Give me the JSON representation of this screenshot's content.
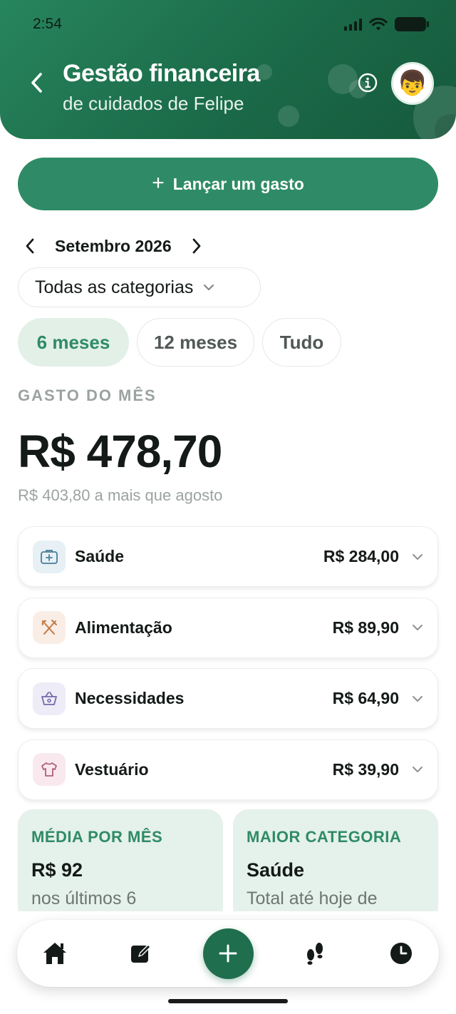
{
  "status_bar": {
    "time": "2:54"
  },
  "header": {
    "title": "Gestão financeira",
    "subtitle": "de cuidados de Felipe",
    "avatar_emoji": "👦",
    "icons": {
      "back": "chevron-left-icon",
      "info": "info-icon"
    }
  },
  "actions": {
    "add_expense_label": "Lançar um gasto",
    "add_expense_icon": "+"
  },
  "filters": {
    "month": "Setembro 2026",
    "category": "Todas as categorias",
    "ranges": [
      {
        "label": "6 meses",
        "active": true
      },
      {
        "label": "12 meses",
        "active": false
      },
      {
        "label": "Tudo",
        "active": false
      }
    ]
  },
  "summary": {
    "caption": "GASTO DO MÊS",
    "total": "R$ 478,70",
    "comparison": "R$ 403,80 a mais que agosto"
  },
  "categories": [
    {
      "name": "Saúde",
      "value": "R$ 284,00",
      "icon": "first-aid-kit-icon",
      "icon_bg": "#e6f0f5",
      "icon_color": "#4a7d99"
    },
    {
      "name": "Alimentação",
      "value": "R$ 89,90",
      "icon": "fork-knife-icon",
      "icon_bg": "#f9ede5",
      "icon_color": "#c27a45"
    },
    {
      "name": "Necessidades",
      "value": "R$ 64,90",
      "icon": "basket-icon",
      "icon_bg": "#eeecf7",
      "icon_color": "#766aa8"
    },
    {
      "name": "Vestuário",
      "value": "R$ 39,90",
      "icon": "tshirt-icon",
      "icon_bg": "#f9e9ee",
      "icon_color": "#b06077"
    }
  ],
  "stats": [
    {
      "label": "MÉDIA POR MÊS",
      "value": "R$ 92",
      "sub": "nos últimos 6"
    },
    {
      "label": "MAIOR CATEGORIA",
      "value": "Saúde",
      "sub": "Total até hoje de"
    }
  ],
  "tabbar": {
    "items": [
      "home-icon",
      "edit-note-icon",
      "add-icon",
      "footprints-icon",
      "clock-icon"
    ]
  },
  "colors": {
    "brand": "#2f8b67",
    "header_dark": "#1b6a48",
    "fab": "#1f6e4d",
    "muted": "#9ba39f"
  }
}
